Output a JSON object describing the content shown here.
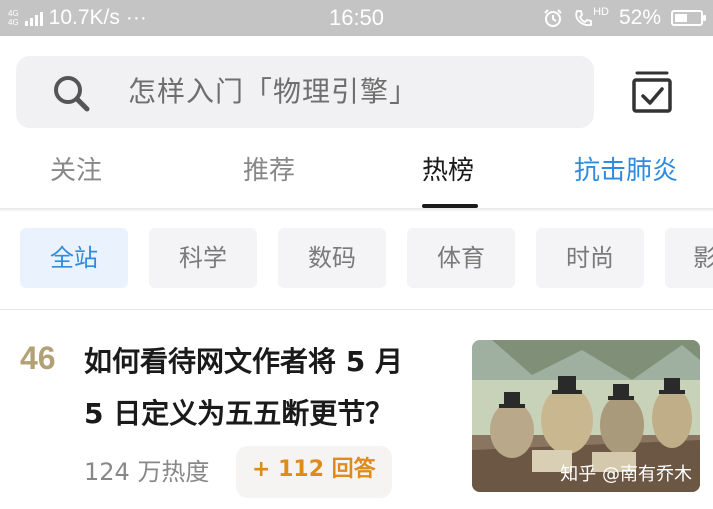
{
  "status_bar": {
    "network_tags": [
      "4G",
      "4G"
    ],
    "speed": "10.7K/s",
    "more": "···",
    "time": "16:50",
    "hd_label": "HD",
    "battery_percent_text": "52%",
    "battery_level": 0.52
  },
  "search": {
    "placeholder_text": "怎样入门「物理引擎」"
  },
  "tabs": [
    {
      "label": "关注"
    },
    {
      "label": "推荐"
    },
    {
      "label": "热榜"
    },
    {
      "label": "抗击肺炎"
    }
  ],
  "active_tab": "热榜",
  "categories": [
    {
      "label": "全站"
    },
    {
      "label": "科学"
    },
    {
      "label": "数码"
    },
    {
      "label": "体育"
    },
    {
      "label": "时尚"
    },
    {
      "label": "影"
    }
  ],
  "hot_item": {
    "rank": "46",
    "title_line1": "如何看待网文作者将 5 月",
    "title_line2": "5 日定义为五五断更节？",
    "heat": "124 万热度",
    "answers": "+ 112 回答",
    "image_watermark": "知乎 @南有乔木"
  },
  "colors": {
    "accent_blue": "#2e8bdf",
    "rank_gold": "#b3a176",
    "answers_orange": "#e08a1e",
    "status_bar_bg": "#c4c4c4"
  }
}
